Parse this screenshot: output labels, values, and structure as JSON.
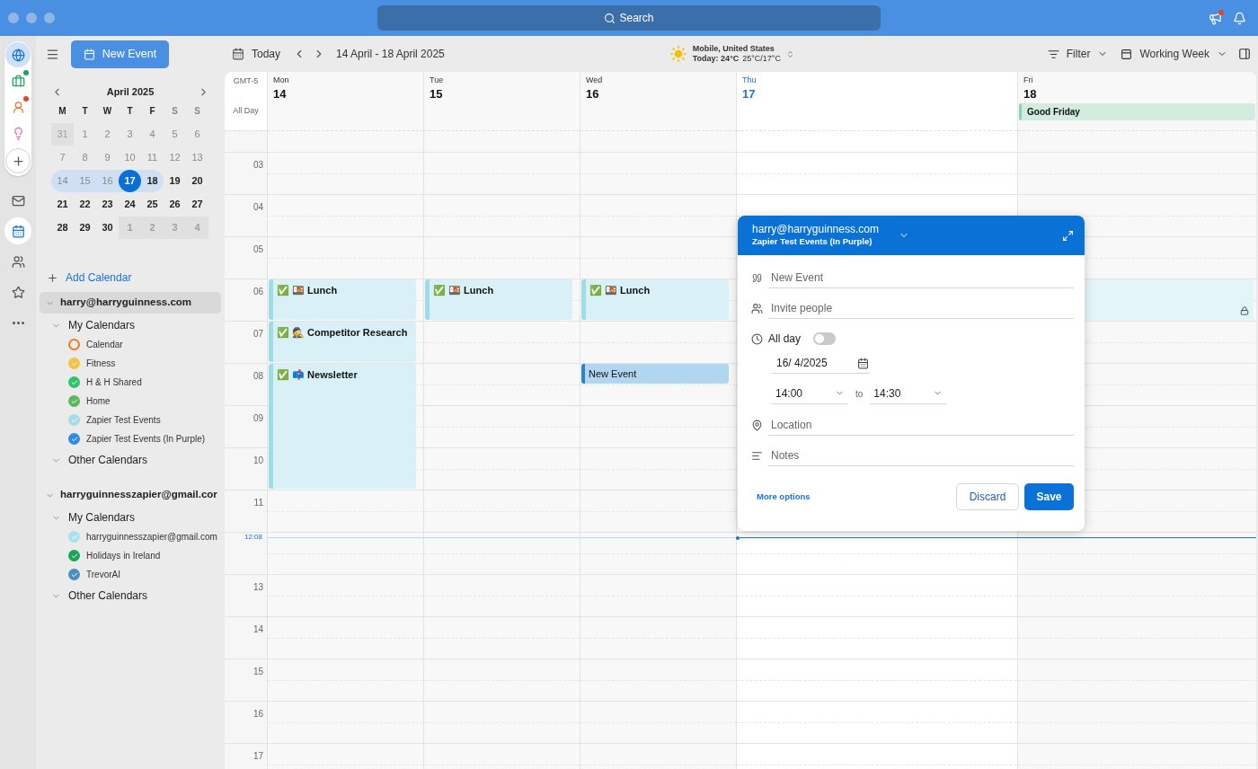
{
  "title_bar": {
    "search": "Search",
    "alert": true
  },
  "rail": {
    "apps": [
      {
        "selected": true
      },
      {
        "selected": false,
        "color": "#1aa260"
      },
      {
        "selected": false,
        "color": "#e8412c"
      },
      {
        "selected": false
      },
      {
        "selected": false
      }
    ],
    "nav": [
      {
        "selected": false
      },
      {
        "selected": true
      },
      {
        "selected": false
      },
      {
        "selected": false
      },
      {
        "selected": false
      }
    ]
  },
  "sidebar": {
    "new_event": "New Event",
    "month": "April 2025",
    "weekdays": [
      {
        "label": "M",
        "weekend": false
      },
      {
        "label": "T",
        "weekend": false
      },
      {
        "label": "W",
        "weekend": false
      },
      {
        "label": "T",
        "weekend": false
      },
      {
        "label": "F",
        "weekend": false
      },
      {
        "label": "S",
        "weekend": true
      },
      {
        "label": "S",
        "weekend": true
      }
    ],
    "weeks": [
      [
        {
          "label": "31",
          "other_month": true,
          "past": true,
          "in_week": false,
          "today": false
        },
        {
          "label": "1",
          "other_month": false,
          "past": true,
          "in_week": false,
          "today": false
        },
        {
          "label": "2",
          "other_month": false,
          "past": true,
          "in_week": false,
          "today": false
        },
        {
          "label": "3",
          "other_month": false,
          "past": true,
          "in_week": false,
          "today": false
        },
        {
          "label": "4",
          "other_month": false,
          "past": true,
          "in_week": false,
          "today": false
        },
        {
          "label": "5",
          "other_month": false,
          "past": true,
          "in_week": false,
          "today": false
        },
        {
          "label": "6",
          "other_month": false,
          "past": true,
          "in_week": false,
          "today": false
        }
      ],
      [
        {
          "label": "7",
          "other_month": false,
          "past": true,
          "in_week": false,
          "today": false
        },
        {
          "label": "8",
          "other_month": false,
          "past": true,
          "in_week": false,
          "today": false
        },
        {
          "label": "9",
          "other_month": false,
          "past": true,
          "in_week": false,
          "today": false
        },
        {
          "label": "10",
          "other_month": false,
          "past": true,
          "in_week": false,
          "today": false
        },
        {
          "label": "11",
          "other_month": false,
          "past": true,
          "in_week": false,
          "today": false
        },
        {
          "label": "12",
          "other_month": false,
          "past": true,
          "in_week": false,
          "today": false
        },
        {
          "label": "13",
          "other_month": false,
          "past": true,
          "in_week": false,
          "today": false
        }
      ],
      [
        {
          "label": "14",
          "other_month": false,
          "past": true,
          "in_week": true,
          "today": false
        },
        {
          "label": "15",
          "other_month": false,
          "past": true,
          "in_week": true,
          "today": false
        },
        {
          "label": "16",
          "other_month": false,
          "past": true,
          "in_week": true,
          "today": false
        },
        {
          "label": "17",
          "other_month": false,
          "past": false,
          "in_week": true,
          "today": true
        },
        {
          "label": "18",
          "other_month": false,
          "past": false,
          "in_week": true,
          "today": false
        },
        {
          "label": "19",
          "other_month": false,
          "past": false,
          "in_week": false,
          "today": false
        },
        {
          "label": "20",
          "other_month": false,
          "past": false,
          "in_week": false,
          "today": false
        }
      ],
      [
        {
          "label": "21",
          "other_month": false,
          "past": false,
          "in_week": false,
          "today": false
        },
        {
          "label": "22",
          "other_month": false,
          "past": false,
          "in_week": false,
          "today": false
        },
        {
          "label": "23",
          "other_month": false,
          "past": false,
          "in_week": false,
          "today": false
        },
        {
          "label": "24",
          "other_month": false,
          "past": false,
          "in_week": false,
          "today": false
        },
        {
          "label": "25",
          "other_month": false,
          "past": false,
          "in_week": false,
          "today": false
        },
        {
          "label": "26",
          "other_month": false,
          "past": false,
          "in_week": false,
          "today": false
        },
        {
          "label": "27",
          "other_month": false,
          "past": false,
          "in_week": false,
          "today": false
        }
      ],
      [
        {
          "label": "28",
          "other_month": false,
          "past": false,
          "in_week": false,
          "today": false
        },
        {
          "label": "29",
          "other_month": false,
          "past": false,
          "in_week": false,
          "today": false
        },
        {
          "label": "30",
          "other_month": false,
          "past": false,
          "in_week": false,
          "today": false
        },
        {
          "label": "1",
          "other_month": true,
          "past": false,
          "in_week": false,
          "today": false
        },
        {
          "label": "2",
          "other_month": true,
          "past": false,
          "in_week": false,
          "today": false
        },
        {
          "label": "3",
          "other_month": true,
          "past": false,
          "in_week": false,
          "today": false
        },
        {
          "label": "4",
          "other_month": true,
          "past": false,
          "in_week": false,
          "today": false
        }
      ]
    ],
    "add_calendar": "Add Calendar",
    "accounts": [
      {
        "name": "harry@harryguinness.com",
        "selected": true,
        "groups": [
          {
            "name": "My Calendars",
            "calendars": [
              {
                "name": "Calendar",
                "color": "#f07a1c",
                "checked": false
              },
              {
                "name": "Fitness",
                "color": "#f5c342",
                "checked": true
              },
              {
                "name": "H & H Shared",
                "color": "#2fc46a",
                "checked": true
              },
              {
                "name": "Home",
                "color": "#5cb85c",
                "checked": true
              },
              {
                "name": "Zapier Test Events",
                "color": "#a3dde6",
                "checked": true
              },
              {
                "name": "Zapier Test Events (In Purple)",
                "color": "#2f8be6",
                "checked": true
              }
            ]
          },
          {
            "name": "Other Calendars"
          }
        ]
      },
      {
        "name": "harryguinnesszapier@gmail.cor",
        "selected": false,
        "groups": [
          {
            "name": "My Calendars",
            "calendars": [
              {
                "name": "harryguinnesszapier@gmail.com",
                "color": "#a8e3ec",
                "checked": true
              },
              {
                "name": "Holidays in Ireland",
                "color": "#19a55a",
                "checked": true
              },
              {
                "name": "TrevorAI",
                "color": "#4a8fc4",
                "checked": true
              }
            ]
          },
          {
            "name": "Other Calendars"
          }
        ]
      }
    ]
  },
  "toolbar": {
    "today": "Today",
    "range": "14 April - 18 April 2025",
    "weather": {
      "location": "Mobile, United States",
      "today": "Today: 24°C",
      "range": "25°C/17°C"
    },
    "filter": "Filter",
    "view": "Working Week"
  },
  "grid": {
    "timezone": "GMT-5",
    "all_day": "All Day",
    "hours": [
      {
        "label": "03"
      },
      {
        "label": "04"
      },
      {
        "label": "05"
      },
      {
        "label": "06",
        "cells": [
          {
            "title": "✅ 🍱 Lunch",
            "kind": "task"
          },
          {
            "title": "✅ 🍱 Lunch",
            "kind": "task"
          },
          {
            "title": "✅ 🍱 Lunch",
            "kind": "task"
          },
          {},
          {
            "kind": "private"
          }
        ]
      },
      {
        "label": "07",
        "cells": [
          {
            "title": "✅ 🕵️ Competitor Research",
            "kind": "task"
          },
          {},
          {},
          {},
          {}
        ]
      },
      {
        "label": "08",
        "cells": [
          {
            "title": "✅ 📫 Newsletter",
            "kind": "task"
          },
          {},
          {
            "title": "New Event",
            "kind": "draft"
          },
          {},
          {}
        ]
      },
      {
        "label": "09",
        "cells": [
          {
            "continued": true
          },
          {},
          {},
          {},
          {}
        ]
      },
      {
        "label": "10",
        "cells": [
          {
            "continued": true
          },
          {},
          {},
          {},
          {}
        ]
      },
      {
        "label": "11"
      },
      {
        "current_time": "12:08"
      },
      {
        "label": "13"
      },
      {
        "label": "14"
      },
      {
        "label": "15"
      },
      {
        "label": "16"
      },
      {
        "label": "17"
      }
    ],
    "days": [
      {
        "name": "Mon",
        "date": "14",
        "today": false
      },
      {
        "name": "Tue",
        "date": "15",
        "today": false
      },
      {
        "name": "Wed",
        "date": "16",
        "today": false
      },
      {
        "name": "Thu",
        "date": "17",
        "today": true
      },
      {
        "name": "Fri",
        "date": "18",
        "today": false,
        "all_day": [
          {
            "title": "Good Friday"
          }
        ]
      }
    ]
  },
  "popup": {
    "account": "harry@harryguinness.com",
    "calendar": "Zapier Test Events (In Purple)",
    "title_placeholder": "New Event",
    "invite_placeholder": "Invite people",
    "all_day_label": "All day",
    "all_day": false,
    "date": "16/ 4/2025",
    "start": "14:00",
    "to": "to",
    "end": "14:30",
    "location_placeholder": "Location",
    "notes_placeholder": "Notes",
    "more_options": "More options",
    "discard": "Discard",
    "save": "Save"
  }
}
